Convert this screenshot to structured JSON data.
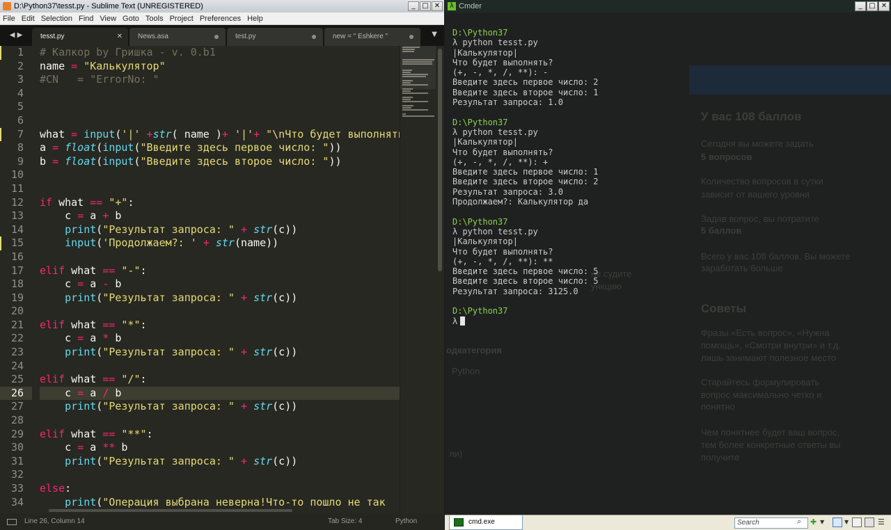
{
  "sublime": {
    "title": "D:\\Python37\\tesst.py - Sublime Text (UNREGISTERED)",
    "menu": [
      "File",
      "Edit",
      "Selection",
      "Find",
      "View",
      "Goto",
      "Tools",
      "Project",
      "Preferences",
      "Help"
    ],
    "tab_nav": "◀ ▶",
    "tabs": [
      {
        "label": "tesst.py",
        "active": true,
        "close": "✕"
      },
      {
        "label": "News.asa",
        "active": false
      },
      {
        "label": "test.py",
        "active": false
      },
      {
        "label": "new = \" Eshkere \"",
        "active": false
      }
    ],
    "tab_dropdown": "▼",
    "status": {
      "position": "Line 26, Column 14",
      "tab_size": "Tab Size: 4",
      "syntax": "Python"
    },
    "current_line": 26,
    "modified_lines": [
      1,
      7,
      15
    ],
    "code": [
      [
        [
          "cm",
          "# Калкор by Гришка - v. 0.b1"
        ]
      ],
      [
        [
          "",
          "name "
        ],
        [
          "kw",
          "="
        ],
        [
          "",
          " "
        ],
        [
          "st",
          "\"Калькулятор\""
        ]
      ],
      [
        [
          "cm",
          "#CN   = \"ErrorNo: \""
        ]
      ],
      [],
      [],
      [],
      [
        [
          "",
          "what "
        ],
        [
          "kw",
          "="
        ],
        [
          "",
          " "
        ],
        [
          "bi",
          "input"
        ],
        [
          "",
          "("
        ],
        [
          "st",
          "'|'"
        ],
        [
          "",
          " "
        ],
        [
          "kw",
          "+"
        ],
        [
          "bii",
          "str"
        ],
        [
          "",
          "( name )"
        ],
        [
          "kw",
          "+"
        ],
        [
          "",
          " "
        ],
        [
          "st",
          "'|'"
        ],
        [
          "kw",
          "+"
        ],
        [
          "",
          " "
        ],
        [
          "st",
          "\"\\nЧто будет выполнять"
        ]
      ],
      [
        [
          "",
          "a "
        ],
        [
          "kw",
          "="
        ],
        [
          "",
          " "
        ],
        [
          "bii",
          "float"
        ],
        [
          "",
          "("
        ],
        [
          "bi",
          "input"
        ],
        [
          "",
          "("
        ],
        [
          "st",
          "\"Введите здесь первое число: \""
        ],
        [
          "",
          "))"
        ]
      ],
      [
        [
          "",
          "b "
        ],
        [
          "kw",
          "="
        ],
        [
          "",
          " "
        ],
        [
          "bii",
          "float"
        ],
        [
          "",
          "("
        ],
        [
          "bi",
          "input"
        ],
        [
          "",
          "("
        ],
        [
          "st",
          "\"Введите здесь второе число: \""
        ],
        [
          "",
          "))"
        ]
      ],
      [],
      [],
      [
        [
          "kw",
          "if"
        ],
        [
          "",
          " what "
        ],
        [
          "kw",
          "=="
        ],
        [
          "",
          " "
        ],
        [
          "st",
          "\"+\""
        ],
        [
          "",
          ":"
        ]
      ],
      [
        [
          "",
          "    c "
        ],
        [
          "kw",
          "="
        ],
        [
          "",
          " a "
        ],
        [
          "kw",
          "+"
        ],
        [
          "",
          " b"
        ]
      ],
      [
        [
          "",
          "    "
        ],
        [
          "bi",
          "print"
        ],
        [
          "",
          "("
        ],
        [
          "st",
          "\"Результат запроса: \""
        ],
        [
          "",
          " "
        ],
        [
          "kw",
          "+"
        ],
        [
          "",
          " "
        ],
        [
          "bii",
          "str"
        ],
        [
          "",
          "(c))"
        ]
      ],
      [
        [
          "",
          "    "
        ],
        [
          "bi",
          "input"
        ],
        [
          "",
          "("
        ],
        [
          "st",
          "'Продолжаем?: '"
        ],
        [
          "",
          " "
        ],
        [
          "kw",
          "+"
        ],
        [
          "",
          " "
        ],
        [
          "bii",
          "str"
        ],
        [
          "",
          "(name))"
        ]
      ],
      [],
      [
        [
          "kw",
          "elif"
        ],
        [
          "",
          " what "
        ],
        [
          "kw",
          "=="
        ],
        [
          "",
          " "
        ],
        [
          "st",
          "\"-\""
        ],
        [
          "",
          ":"
        ]
      ],
      [
        [
          "",
          "    c "
        ],
        [
          "kw",
          "="
        ],
        [
          "",
          " a "
        ],
        [
          "kw",
          "-"
        ],
        [
          "",
          " b"
        ]
      ],
      [
        [
          "",
          "    "
        ],
        [
          "bi",
          "print"
        ],
        [
          "",
          "("
        ],
        [
          "st",
          "\"Результат запроса: \""
        ],
        [
          "",
          " "
        ],
        [
          "kw",
          "+"
        ],
        [
          "",
          " "
        ],
        [
          "bii",
          "str"
        ],
        [
          "",
          "(c))"
        ]
      ],
      [],
      [
        [
          "kw",
          "elif"
        ],
        [
          "",
          " what "
        ],
        [
          "kw",
          "=="
        ],
        [
          "",
          " "
        ],
        [
          "st",
          "\"*\""
        ],
        [
          "",
          ":"
        ]
      ],
      [
        [
          "",
          "    c "
        ],
        [
          "kw",
          "="
        ],
        [
          "",
          " a "
        ],
        [
          "kw",
          "*"
        ],
        [
          "",
          " b"
        ]
      ],
      [
        [
          "",
          "    "
        ],
        [
          "bi",
          "print"
        ],
        [
          "",
          "("
        ],
        [
          "st",
          "\"Результат запроса: \""
        ],
        [
          "",
          " "
        ],
        [
          "kw",
          "+"
        ],
        [
          "",
          " "
        ],
        [
          "bii",
          "str"
        ],
        [
          "",
          "(c))"
        ]
      ],
      [],
      [
        [
          "kw",
          "elif"
        ],
        [
          "",
          " what "
        ],
        [
          "kw",
          "=="
        ],
        [
          "",
          " "
        ],
        [
          "st",
          "\"/\""
        ],
        [
          "",
          ":"
        ]
      ],
      [
        [
          "",
          "    c "
        ],
        [
          "kw",
          "="
        ],
        [
          "",
          " a "
        ],
        [
          "kw",
          "/"
        ],
        [
          "",
          " b"
        ]
      ],
      [
        [
          "",
          "    "
        ],
        [
          "bi",
          "print"
        ],
        [
          "",
          "("
        ],
        [
          "st",
          "\"Результат запроса: \""
        ],
        [
          "",
          " "
        ],
        [
          "kw",
          "+"
        ],
        [
          "",
          " "
        ],
        [
          "bii",
          "str"
        ],
        [
          "",
          "(c))"
        ]
      ],
      [],
      [
        [
          "kw",
          "elif"
        ],
        [
          "",
          " what "
        ],
        [
          "kw",
          "=="
        ],
        [
          "",
          " "
        ],
        [
          "st",
          "\"**\""
        ],
        [
          "",
          ":"
        ]
      ],
      [
        [
          "",
          "    c "
        ],
        [
          "kw",
          "="
        ],
        [
          "",
          " a "
        ],
        [
          "kw",
          "**"
        ],
        [
          "",
          " b"
        ]
      ],
      [
        [
          "",
          "    "
        ],
        [
          "bi",
          "print"
        ],
        [
          "",
          "("
        ],
        [
          "st",
          "\"Результат запроса: \""
        ],
        [
          "",
          " "
        ],
        [
          "kw",
          "+"
        ],
        [
          "",
          " "
        ],
        [
          "bii",
          "str"
        ],
        [
          "",
          "(c))"
        ]
      ],
      [],
      [
        [
          "kw",
          "else"
        ],
        [
          "",
          ":"
        ]
      ],
      [
        [
          "",
          "    "
        ],
        [
          "bi",
          "print"
        ],
        [
          "",
          "("
        ],
        [
          "st",
          "\"Операция выбрана неверна!Что-то пошло не так"
        ]
      ]
    ]
  },
  "cmder": {
    "title": "Cmder",
    "terminal": [
      {
        "text": "D:\\Python37",
        "kind": "path"
      },
      {
        "text": "λ python tesst.py",
        "kind": "cmd"
      },
      {
        "text": "|Калькулятор|",
        "kind": "out"
      },
      {
        "text": "Что будет выполнять?",
        "kind": "out"
      },
      {
        "text": "(+, -, *, /, **): -",
        "kind": "out"
      },
      {
        "text": "Введите здесь первое число: 2",
        "kind": "out"
      },
      {
        "text": "Введите здесь второе число: 1",
        "kind": "out"
      },
      {
        "text": "Результат запроса: 1.0",
        "kind": "out"
      },
      {
        "text": "",
        "kind": "out"
      },
      {
        "text": "D:\\Python37",
        "kind": "path"
      },
      {
        "text": "λ python tesst.py",
        "kind": "cmd"
      },
      {
        "text": "|Калькулятор|",
        "kind": "out"
      },
      {
        "text": "Что будет выполнять?",
        "kind": "out"
      },
      {
        "text": "(+, -, *, /, **): +",
        "kind": "out"
      },
      {
        "text": "Введите здесь первое число: 1",
        "kind": "out"
      },
      {
        "text": "Введите здесь второе число: 2",
        "kind": "out"
      },
      {
        "text": "Результат запроса: 3.0",
        "kind": "out"
      },
      {
        "text": "Продолжаем?: Калькулятор да",
        "kind": "out"
      },
      {
        "text": "",
        "kind": "out"
      },
      {
        "text": "D:\\Python37",
        "kind": "path"
      },
      {
        "text": "λ python tesst.py",
        "kind": "cmd"
      },
      {
        "text": "|Калькулятор|",
        "kind": "out"
      },
      {
        "text": "Что будет выполнять?",
        "kind": "out"
      },
      {
        "text": "(+, -, *, /, **): **",
        "kind": "out"
      },
      {
        "text": "Введите здесь первое число: 5",
        "kind": "out"
      },
      {
        "text": "Введите здесь второе число: 5",
        "kind": "out"
      },
      {
        "text": "Результат запроса: 3125.0",
        "kind": "out"
      },
      {
        "text": "",
        "kind": "out"
      },
      {
        "text": "D:\\Python37",
        "kind": "path"
      },
      {
        "text": "λ",
        "kind": "prompt"
      }
    ],
    "ghost": [
      {
        "text": "У вас 108 баллов",
        "bold": true
      },
      {
        "text": "Сегодня вы можете задать"
      },
      {
        "text": "5 вопросов",
        "bold": true
      },
      {
        "text": "Количество вопросов в сутки"
      },
      {
        "text": "зависит от вашего уровня"
      },
      {
        "text": "Задав вопрос, вы потратите"
      },
      {
        "text": "5 баллов",
        "bold": true
      },
      {
        "text": "Всего у вас 108 баллов. Вы можете"
      },
      {
        "text": "заработать больше"
      },
      {
        "text": "Советы",
        "bold": true
      },
      {
        "text": "Фразы «Есть вопрос», «Нужна"
      },
      {
        "text": "помощь», «Смотри внутри» и т.д."
      },
      {
        "text": "лишь занимают полезное место"
      },
      {
        "text": "Старайтесь формулировать"
      },
      {
        "text": "вопрос максимально четко и"
      },
      {
        "text": "понятно"
      },
      {
        "text": "Чем понятнее будет ваш вопрос,"
      },
      {
        "text": "тем более конкретные ответы вы"
      },
      {
        "text": "получите"
      },
      {
        "text": "одкатегория",
        "bold": true
      },
      {
        "text": "Python"
      },
      {
        "text": "ли)"
      },
      {
        "text": "не судите"
      },
      {
        "text": "ункцию"
      }
    ],
    "bottom": {
      "tab_label": "cmd.exe",
      "search_placeholder": "Search"
    }
  }
}
